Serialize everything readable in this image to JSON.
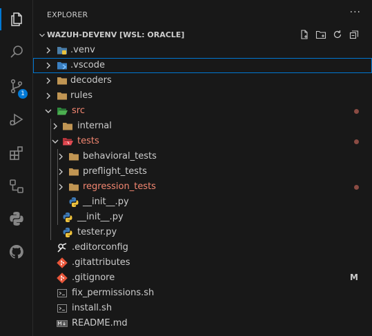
{
  "sidebar": {
    "title": "EXPLORER",
    "more": "···"
  },
  "workspace": {
    "title": "WAZUH-DEVENV [WSL: ORACLE]"
  },
  "activity": {
    "badge": "1"
  },
  "tree": [
    {
      "label": "venv_label",
      "text": ".venv"
    },
    {
      "text": ".vscode"
    },
    {
      "text": "decoders"
    },
    {
      "text": "rules"
    },
    {
      "text": "src"
    },
    {
      "text": "internal"
    },
    {
      "text": "tests"
    },
    {
      "text": "behavioral_tests"
    },
    {
      "text": "preflight_tests"
    },
    {
      "text": "regression_tests"
    },
    {
      "text": "__init__.py"
    },
    {
      "text": "__init__.py"
    },
    {
      "text": "tester.py"
    },
    {
      "text": ".editorconfig"
    },
    {
      "text": ".gitattributes"
    },
    {
      "text": ".gitignore",
      "status": "M"
    },
    {
      "text": "fix_permissions.sh"
    },
    {
      "text": "install.sh"
    },
    {
      "text": "README.md"
    }
  ],
  "colors": {
    "accent": "#0078d4",
    "modified": "#f48771",
    "folder": "#c09553",
    "background": "#181818"
  }
}
